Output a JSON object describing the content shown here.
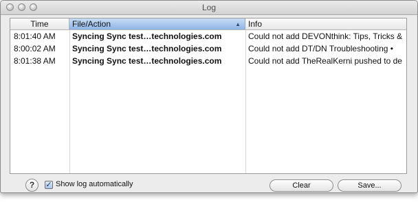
{
  "window": {
    "title": "Log"
  },
  "table": {
    "columns": [
      {
        "label": "Time"
      },
      {
        "label": "File/Action"
      },
      {
        "label": "Info"
      }
    ],
    "sort_indicator": "▲",
    "rows": [
      {
        "time": "8:01:40 AM",
        "file": "Syncing Sync test…technologies.com",
        "info": "Could not add DEVONthink: Tips, Tricks &"
      },
      {
        "time": "8:00:02 AM",
        "file": "Syncing Sync test…technologies.com",
        "info": "Could not add DT/DN Troubleshooting •"
      },
      {
        "time": "8:01:38 AM",
        "file": "Syncing Sync test…technologies.com",
        "info": "Could not add TheRealKerni pushed to de"
      }
    ]
  },
  "footer": {
    "help_label": "?",
    "checkbox_checked": true,
    "checkbox_mark": "✓",
    "checkbox_label": "Show log automatically",
    "clear_label": "Clear",
    "save_label": "Save..."
  }
}
